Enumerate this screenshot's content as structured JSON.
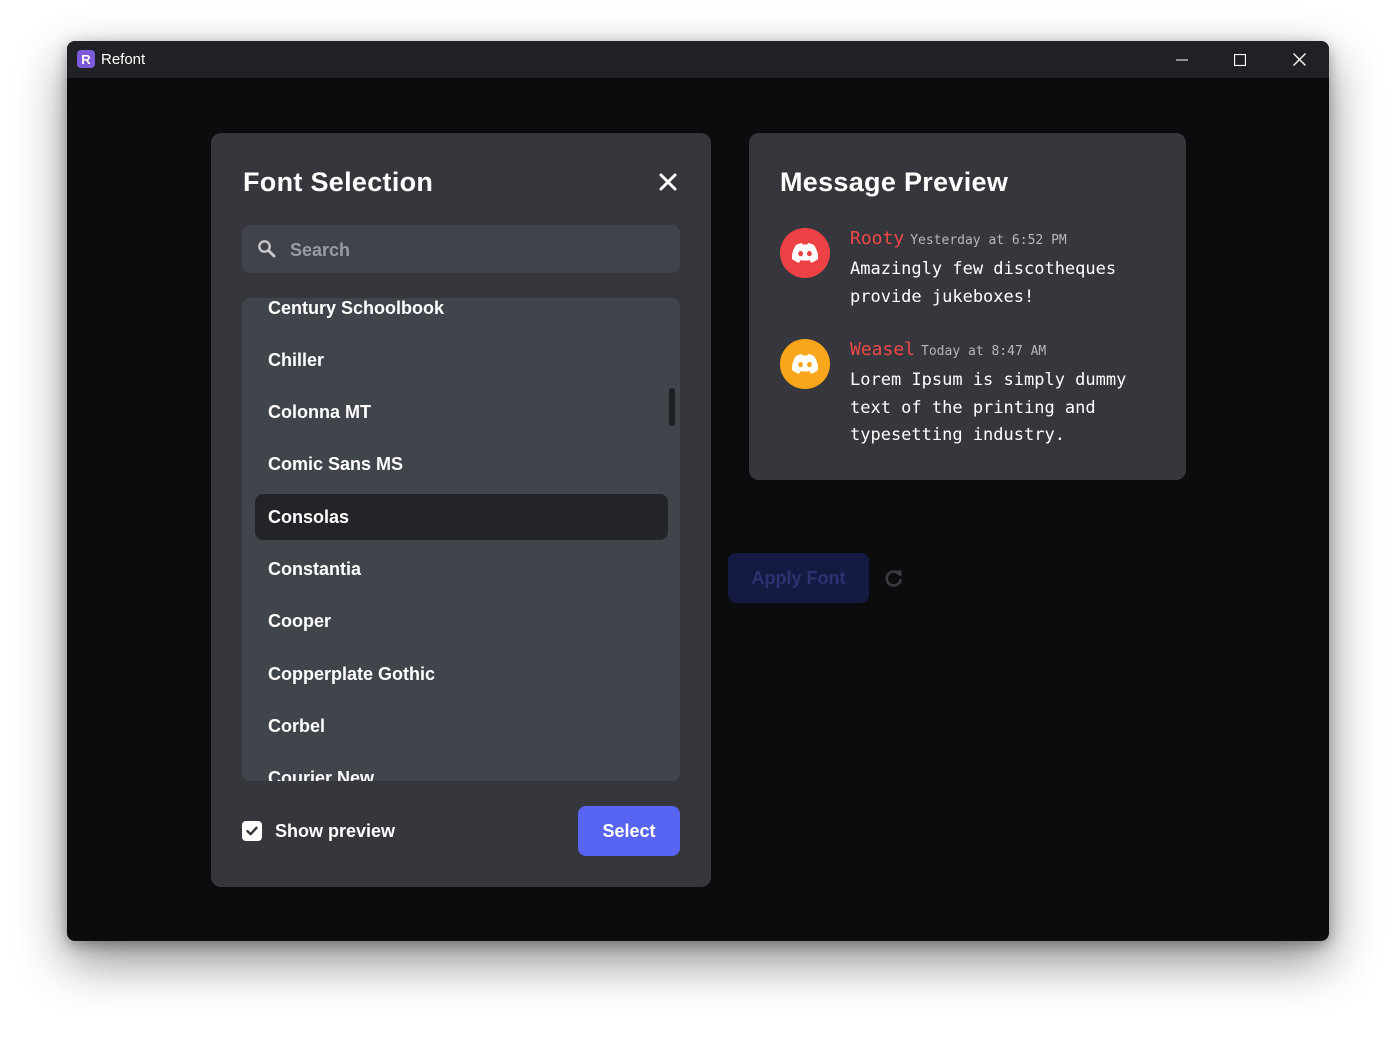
{
  "window": {
    "app_icon_letter": "R",
    "title": "Refont"
  },
  "font_panel": {
    "title": "Font Selection",
    "search": {
      "placeholder": "Search",
      "value": ""
    },
    "fonts": [
      {
        "label": "Century Schoolbook",
        "selected": false
      },
      {
        "label": "Chiller",
        "selected": false
      },
      {
        "label": "Colonna MT",
        "selected": false
      },
      {
        "label": "Comic Sans MS",
        "selected": false
      },
      {
        "label": "Consolas",
        "selected": true
      },
      {
        "label": "Constantia",
        "selected": false
      },
      {
        "label": "Cooper",
        "selected": false
      },
      {
        "label": "Copperplate Gothic",
        "selected": false
      },
      {
        "label": "Corbel",
        "selected": false
      },
      {
        "label": "Courier New",
        "selected": false
      }
    ],
    "show_preview": {
      "label": "Show preview",
      "checked": true
    },
    "select_label": "Select"
  },
  "message_preview": {
    "title": "Message Preview",
    "messages": [
      {
        "username": "Rooty",
        "timestamp": "Yesterday at 6:52 PM",
        "text": "Amazingly few discotheques provide jukeboxes!",
        "avatar_color": "#ed4245"
      },
      {
        "username": "Weasel",
        "timestamp": "Today at 8:47 AM",
        "text": "Lorem Ipsum is simply dummy text of the printing and typesetting industry.",
        "avatar_color": "#faa61a"
      }
    ]
  },
  "actions": {
    "apply_label": "Apply Font"
  },
  "colors": {
    "accent": "#5865f2",
    "username": "#f04747"
  }
}
